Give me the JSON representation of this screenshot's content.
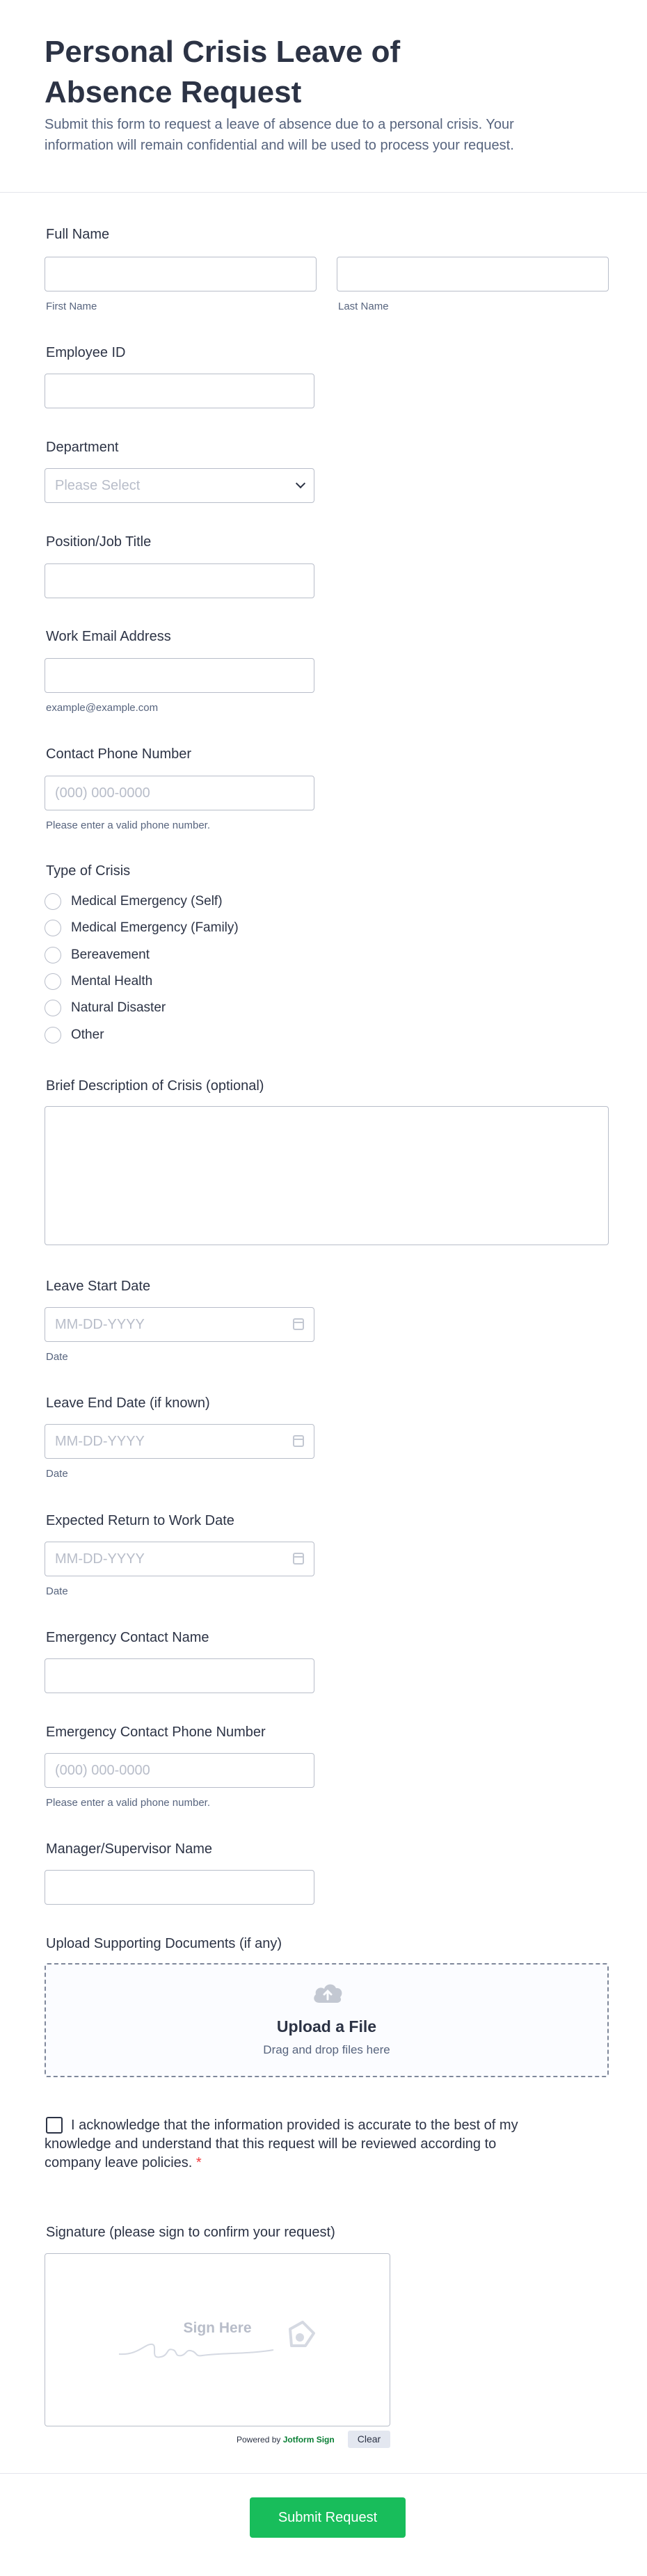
{
  "header": {
    "title": "Personal Crisis Leave of Absence Request",
    "subtitle": "Submit this form to request a leave of absence due to a personal crisis. Your information will remain confidential and will be used to process your request."
  },
  "fields": {
    "full_name": {
      "label": "Full Name",
      "first_sub": "First Name",
      "last_sub": "Last Name"
    },
    "employee_id": {
      "label": "Employee ID"
    },
    "department": {
      "label": "Department",
      "placeholder": "Please Select"
    },
    "position": {
      "label": "Position/Job Title"
    },
    "email": {
      "label": "Work Email Address",
      "sub": "example@example.com"
    },
    "phone": {
      "label": "Contact Phone Number",
      "placeholder": "(000) 000-0000",
      "sub": "Please enter a valid phone number."
    },
    "crisis_type": {
      "label": "Type of Crisis",
      "options": [
        "Medical Emergency (Self)",
        "Medical Emergency (Family)",
        "Bereavement",
        "Mental Health",
        "Natural Disaster",
        "Other"
      ]
    },
    "description": {
      "label": "Brief Description of Crisis (optional)"
    },
    "leave_start": {
      "label": "Leave Start Date",
      "placeholder": "MM-DD-YYYY",
      "sub": "Date"
    },
    "leave_end": {
      "label": "Leave End Date (if known)",
      "placeholder": "MM-DD-YYYY",
      "sub": "Date"
    },
    "return_date": {
      "label": "Expected Return to Work Date",
      "placeholder": "MM-DD-YYYY",
      "sub": "Date"
    },
    "emergency_name": {
      "label": "Emergency Contact Name"
    },
    "emergency_phone": {
      "label": "Emergency Contact Phone Number",
      "placeholder": "(000) 000-0000",
      "sub": "Please enter a valid phone number."
    },
    "manager": {
      "label": "Manager/Supervisor Name"
    },
    "upload": {
      "label": "Upload Supporting Documents (if any)",
      "title": "Upload a File",
      "hint": "Drag and drop files here"
    },
    "acknowledge": {
      "text": "I acknowledge that the information provided is accurate to the best of my knowledge and understand that this request will be reviewed according to company leave policies.",
      "required_mark": "*"
    },
    "signature": {
      "label": "Signature (please sign to confirm your request)",
      "placeholder": "Sign Here",
      "powered_prefix": "Powered by",
      "powered_brand": "Jotform Sign",
      "clear": "Clear"
    }
  },
  "submit": {
    "label": "Submit Request"
  },
  "colors": {
    "accent": "#18bd5b",
    "text": "#2c3345",
    "muted": "#57647e",
    "border": "#b8bdc9",
    "required": "#f23a3c"
  }
}
